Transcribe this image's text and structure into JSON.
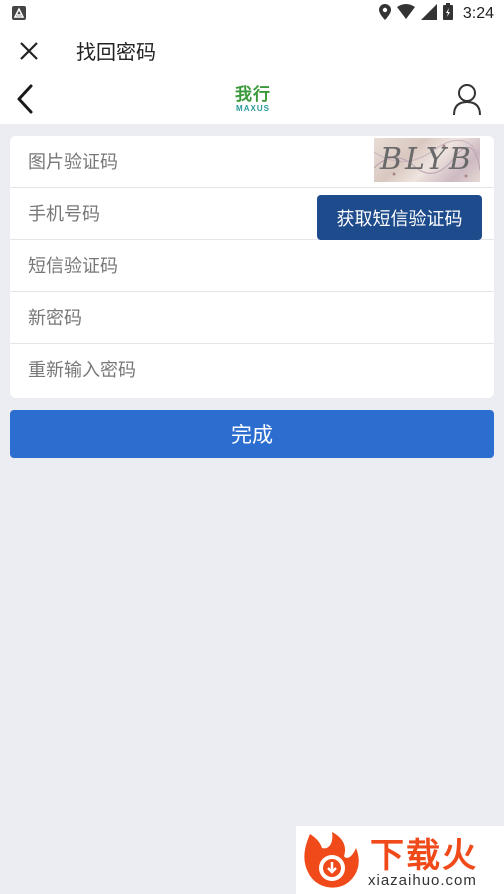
{
  "status_bar": {
    "time": "3:24"
  },
  "window": {
    "title": "找回密码"
  },
  "app_bar": {
    "logo_cn": "我行",
    "logo_en": "MAXUS"
  },
  "form": {
    "image_captcha_placeholder": "图片验证码",
    "captcha_text": "BLYB",
    "phone_placeholder": "手机号码",
    "sms_button_label": "获取短信验证码",
    "sms_code_placeholder": "短信验证码",
    "new_password_placeholder": "新密码",
    "confirm_password_placeholder": "重新输入密码"
  },
  "submit": {
    "label": "完成"
  },
  "watermark": {
    "title": "下载火",
    "url": "xiazaihuo.com"
  },
  "colors": {
    "primary": "#2c6dd0",
    "sms_button": "#1e4b8c",
    "background": "#ebedf2",
    "watermark": "#f04a1a"
  }
}
